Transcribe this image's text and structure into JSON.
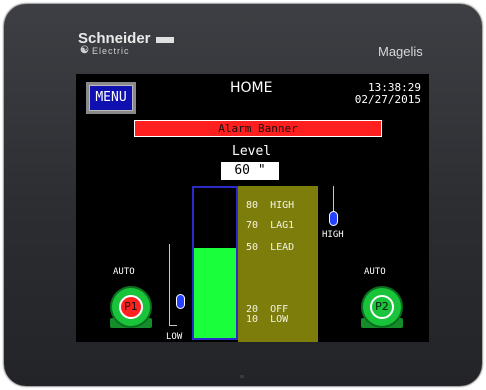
{
  "device": {
    "brand": "Schneider",
    "brand_sub": "Electric",
    "model": "Magelis"
  },
  "screen": {
    "menu_label": "MENU",
    "title": "HOME",
    "time": "13:38:29",
    "date": "02/27/2015",
    "alarm_banner": "Alarm Banner",
    "level_label": "Level",
    "level_value": "60 \"",
    "tank_fill_percent": 60,
    "setpoints": [
      {
        "value": "80",
        "name": "HIGH"
      },
      {
        "value": "70",
        "name": "LAG1"
      },
      {
        "value": "50",
        "name": "LEAD"
      },
      {
        "value": "20",
        "name": "OFF"
      },
      {
        "value": "10",
        "name": "LOW"
      }
    ],
    "high_switch_label": "HIGH",
    "low_switch_label": "LOW",
    "pumps": [
      {
        "label": "P1",
        "mode": "AUTO",
        "status_color": "#ff2020"
      },
      {
        "label": "P2",
        "mode": "AUTO",
        "status_color": "#19c43a"
      }
    ],
    "colors": {
      "tank_fill": "#19ff3c",
      "setpoint_panel": "#7d7d0c",
      "alarm": "#ff1f1f",
      "menu": "#1010b0"
    }
  }
}
